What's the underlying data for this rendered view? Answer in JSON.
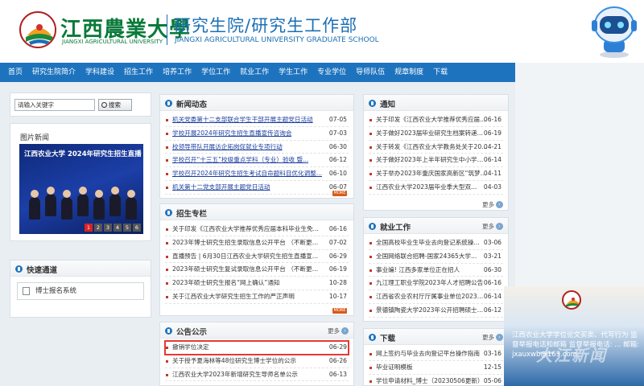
{
  "header": {
    "school_cn": "江西農業大學",
    "school_en": "JIANGXI AGRICULTURAL UNIVERSITY",
    "dept_cn": "研究生院/研究生工作部",
    "dept_en": "JIANGXI AGRICULTURAL UNIVERSITY GRADUATE SCHOOL"
  },
  "nav": [
    "首页",
    "研究生院简介",
    "学科建设",
    "招生工作",
    "培养工作",
    "学位工作",
    "就业工作",
    "学生工作",
    "专业学位",
    "导师队伍",
    "规章制度",
    "下载"
  ],
  "search": {
    "value": "请输入关键字",
    "button": "搜索"
  },
  "photo_news": {
    "title": "图片新闻",
    "banner": "江西农业大学 2024年研究生招生直播",
    "pages": [
      "1",
      "2",
      "3",
      "4",
      "5",
      "6"
    ],
    "active_page": "1"
  },
  "quick_links": {
    "title": "快速通道",
    "items": [
      "博士报名系统"
    ]
  },
  "news": {
    "title": "新闻动态",
    "more": "MORE",
    "items": [
      {
        "text": "机关党委第十二支部联合学生干部开展主题党日活动",
        "date": "07-05"
      },
      {
        "text": "学校开展2024年研究生招生直播宣传咨询会",
        "date": "07-03"
      },
      {
        "text": "校领导带队开展访企拓岗促就业专项行动",
        "date": "06-30"
      },
      {
        "text": "学校召开“十三五”校级重点学科（专业）验收 暨...",
        "date": "06-12"
      },
      {
        "text": "学校召开2024年研究生招生考试自命题科目优化调整...",
        "date": "06-10"
      },
      {
        "text": "机关第十二党支部开展主题党日活动",
        "date": "06-07"
      }
    ]
  },
  "admissions": {
    "title": "招生专栏",
    "more": "MORE",
    "items": [
      {
        "text": "关于印发《江西农业大学推荐优秀应届本科毕业生免...",
        "date": "06-16"
      },
      {
        "text": "2023年博士研究生招生录取信息公开平台 （不断更新...",
        "date": "07-02"
      },
      {
        "text": "直播预告 | 6月30日江西农业大学研究生招生直播宣...",
        "date": "06-29"
      },
      {
        "text": "2023年硕士研究生复试录取信息公开平台 （不断更新...",
        "date": "06-19"
      },
      {
        "text": "2023年硕士研究生报名“网上确认”通知",
        "date": "10-28"
      },
      {
        "text": "关于江西农业大学研究生招生工作的严正声明",
        "date": "10-17"
      }
    ]
  },
  "announcements": {
    "title": "公告公示",
    "more": "更多",
    "items": [
      {
        "text": "撤销学位决定",
        "date": "06-29"
      },
      {
        "text": "关于授予夏海林等48位研究生博士学位的公示",
        "date": "06-26"
      },
      {
        "text": "江西农业大学2023年新增研究生导师名单公示",
        "date": "06-13"
      }
    ]
  },
  "notices": {
    "title": "通知",
    "more": "更多",
    "items": [
      {
        "text": "关于印发《江西农业大学推荐优秀应届...",
        "date": "06-16"
      },
      {
        "text": "关于做好2023届毕业研究生档案转递...",
        "date": "06-19"
      },
      {
        "text": "关于转发《江西农业大学教务处关于20...",
        "date": "04-21"
      },
      {
        "text": "关于做好2023年上半年研究生中小学教...",
        "date": "06-14"
      },
      {
        "text": "关于举办2023年重庆国家高新区“筑梦...",
        "date": "04-11"
      },
      {
        "text": "江西农业大学2023届毕业季大型双...",
        "date": "04-03"
      }
    ]
  },
  "employment": {
    "title": "就业工作",
    "more": "更多",
    "items": [
      {
        "text": "全国高校毕业生毕业去向登记系统操...",
        "date": "03-06"
      },
      {
        "text": "全国网络联合招聘-国家24365大学...",
        "date": "03-21"
      },
      {
        "text": "事业编! 江西多家单位正在招人",
        "date": "06-30"
      },
      {
        "text": "九江理工职业学院2023年人才招聘公告",
        "date": "06-16"
      },
      {
        "text": "江西省农业农村厅厅属事业单位2023年...",
        "date": "06-14"
      },
      {
        "text": "景德镇陶瓷大学2023年公开招聘硕士思...",
        "date": "06-12"
      }
    ]
  },
  "downloads": {
    "title": "下载",
    "more": "更多",
    "items": [
      {
        "text": "网上签约与毕业去向登记平台操作指南",
        "date": "03-16"
      },
      {
        "text": "毕业证明模板",
        "date": "12-15"
      },
      {
        "text": "学位申请材料_博士（20230506更新）",
        "date": "05-06"
      }
    ]
  },
  "promo": {
    "text": "江西农业大学学位论文买卖、代写行为 监督举报电话和邮箱 监督举报电话: ... 邮箱: jxauxwb@163.com",
    "watermark": "大江新闻"
  }
}
